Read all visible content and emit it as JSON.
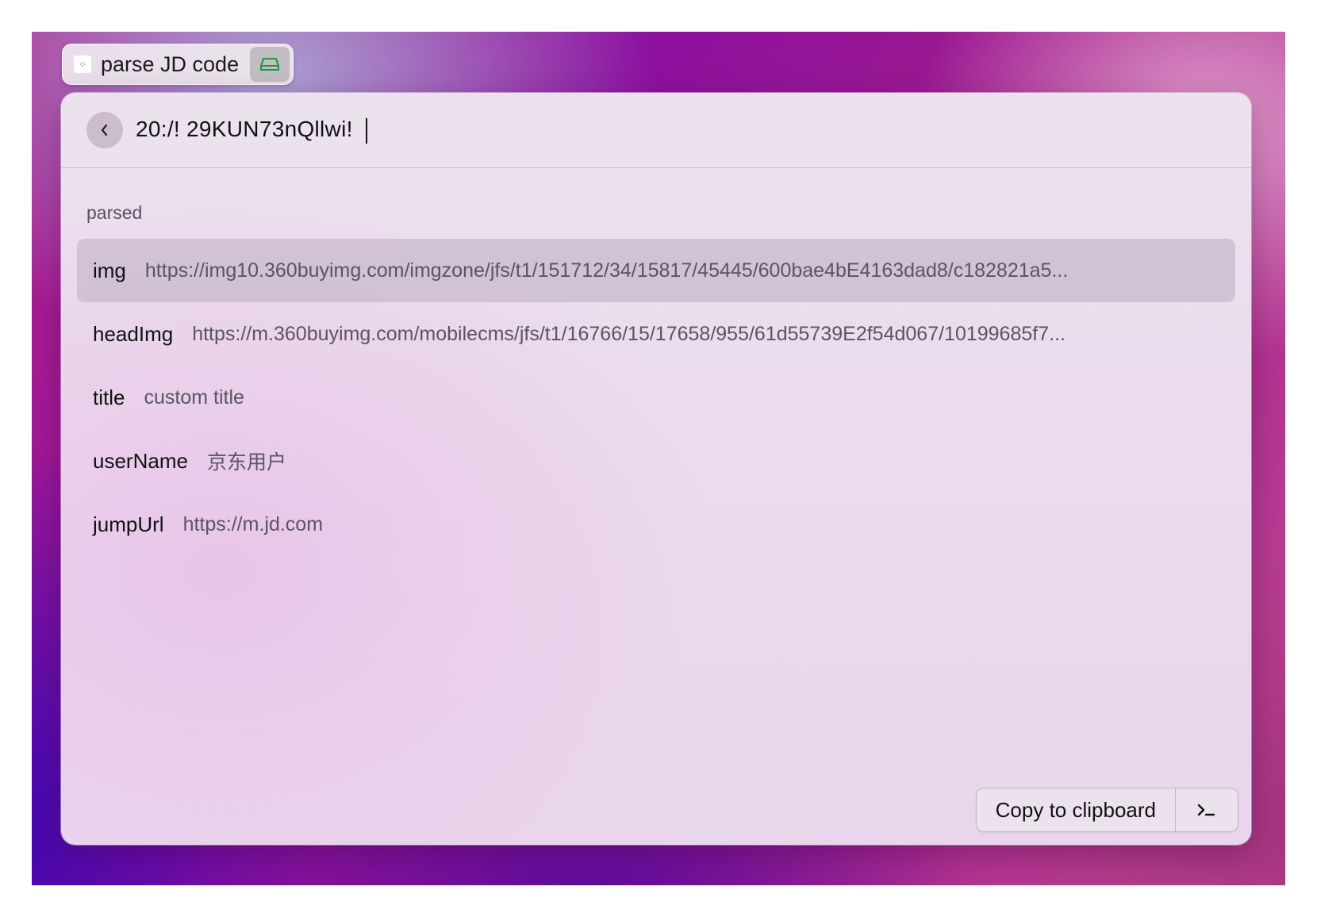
{
  "tab": {
    "title": "parse JD code",
    "icon": "extension-icon",
    "badge_icon": "disk-icon"
  },
  "search": {
    "value": "20:/!  29KUN73nQllwi!"
  },
  "section": {
    "title": "parsed"
  },
  "items": [
    {
      "key": "img",
      "value": "https://img10.360buyimg.com/imgzone/jfs/t1/151712/34/15817/45445/600bae4bE4163dad8/c182821a5...",
      "selected": true
    },
    {
      "key": "headImg",
      "value": "https://m.360buyimg.com/mobilecms/jfs/t1/16766/15/17658/955/61d55739E2f54d067/10199685f7...",
      "selected": false
    },
    {
      "key": "title",
      "value": "custom title",
      "selected": false
    },
    {
      "key": "userName",
      "value": "京东用户",
      "selected": false
    },
    {
      "key": "jumpUrl",
      "value": "https://m.jd.com",
      "selected": false
    }
  ],
  "actions": {
    "primary_label": "Copy to clipboard",
    "secondary_icon": "terminal-icon"
  },
  "colors": {
    "selected_row": "#d6c6d6",
    "badge_icon": "#1a9a3a"
  }
}
